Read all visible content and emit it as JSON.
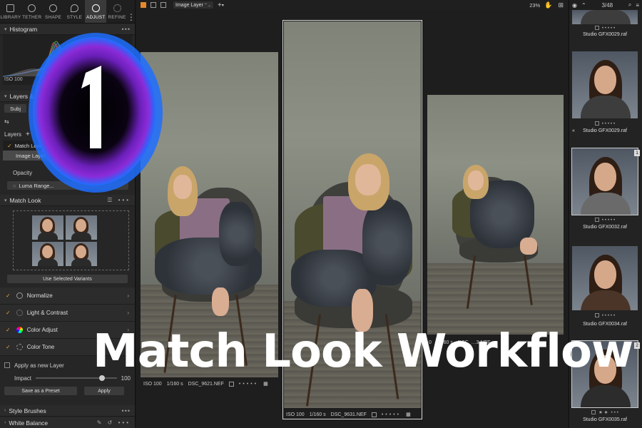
{
  "tool_tabs": [
    {
      "label": "LIBRARY",
      "icon": "library-icon"
    },
    {
      "label": "TETHER",
      "icon": "camera-icon"
    },
    {
      "label": "SHAPE",
      "icon": "shape-icon"
    },
    {
      "label": "STYLE",
      "icon": "style-icon"
    },
    {
      "label": "ADJUST",
      "icon": "adjust-icon",
      "active": true
    },
    {
      "label": "REFINE",
      "icon": "refine-icon"
    }
  ],
  "histogram": {
    "title": "Histogram",
    "iso": "ISO 100"
  },
  "layers": {
    "title": "Layers & M",
    "subject_button": "Subj",
    "layers_label": "Layers",
    "items": [
      "Match Look",
      "Image Layer"
    ],
    "opacity_label": "Opacity",
    "luma_button": "Luma Range..."
  },
  "match_look": {
    "title": "Match Look",
    "use_variants_button": "Use Selected Variants",
    "adjustments": [
      {
        "label": "Normalize",
        "icon": "normalize-icon"
      },
      {
        "label": "Light & Contrast",
        "icon": "light-icon"
      },
      {
        "label": "Color Adjust",
        "icon": "color-wheel-icon"
      },
      {
        "label": "Color Tone",
        "icon": "tone-icon"
      }
    ],
    "apply_new_layer": "Apply as new Layer",
    "impact_label": "Impact",
    "impact_value": "100",
    "impact_fraction": 0.82,
    "save_preset_button": "Save as a Preset",
    "apply_button": "Apply"
  },
  "bottom_sections": [
    "Style Brushes",
    "White Balance"
  ],
  "topbar": {
    "layer_dropdown": "Image Layer",
    "zoom": "23%"
  },
  "viewer": {
    "captions": [
      {
        "iso": "ISO 100",
        "shutter": "1/160 s",
        "file": "DSC_9621.NEF"
      },
      {
        "iso": "ISO 100",
        "shutter": "1/160 s",
        "file": "DSC_9631.NEF"
      },
      {
        "iso": "0",
        "shutter": "1/160 s",
        "file": "DSC_…3.NEF"
      }
    ]
  },
  "overlay_title": "Match Look Workflow",
  "logo_mark": "1",
  "filmstrip": {
    "counter": "3/48",
    "items": [
      {
        "name": "Studio GFX0029.raf",
        "badge": ""
      },
      {
        "name": "Studio GFX0029.raf",
        "badge": ""
      },
      {
        "name": "Studio GFX0032.raf",
        "badge": "1"
      },
      {
        "name": "Studio GFX0034.raf",
        "badge": ""
      },
      {
        "name": "Studio GFX0035.raf",
        "badge": "2"
      }
    ],
    "rating_stars": "★ ★"
  },
  "colors": {
    "accent": "#e6892c",
    "check": "#e6a13a",
    "logo_glow": "#1e6fff",
    "logo_core": "#8b2bd9"
  }
}
